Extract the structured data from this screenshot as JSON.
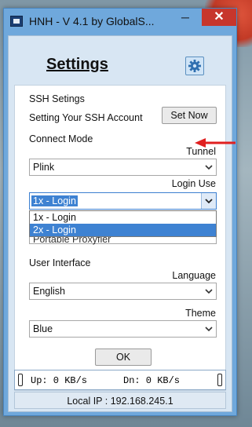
{
  "window": {
    "title": "HNH - V 4.1 by GlobalS..."
  },
  "header": {
    "title": "Settings"
  },
  "ssh": {
    "section_label": "SSH Setings",
    "account_label": "Setting Your SSH Account",
    "set_now_label": "Set Now"
  },
  "connect": {
    "mode_label": "Connect Mode",
    "tunnel_label": "Tunnel",
    "tunnel_value": "Plink",
    "login_use_label": "Login Use",
    "login_use_value": "1x - Login",
    "login_use_options": [
      "1x - Login",
      "2x - Login"
    ],
    "highlighted_option": "2x - Login",
    "hidden_select_value": "Portable Proxyfier"
  },
  "ui": {
    "section_label": "User Interface",
    "language_label": "Language",
    "language_value": "English",
    "theme_label": "Theme",
    "theme_value": "Blue"
  },
  "actions": {
    "ok_label": "OK"
  },
  "status": {
    "up": "Up: 0 KB/s",
    "dn": "Dn: 0 KB/s",
    "local_ip": "Local IP : 192.168.245.1"
  },
  "colors": {
    "accent": "#3e82d2",
    "frame": "#6fa8dc",
    "close": "#c7362c",
    "annotation_arrow": "#e02020"
  }
}
